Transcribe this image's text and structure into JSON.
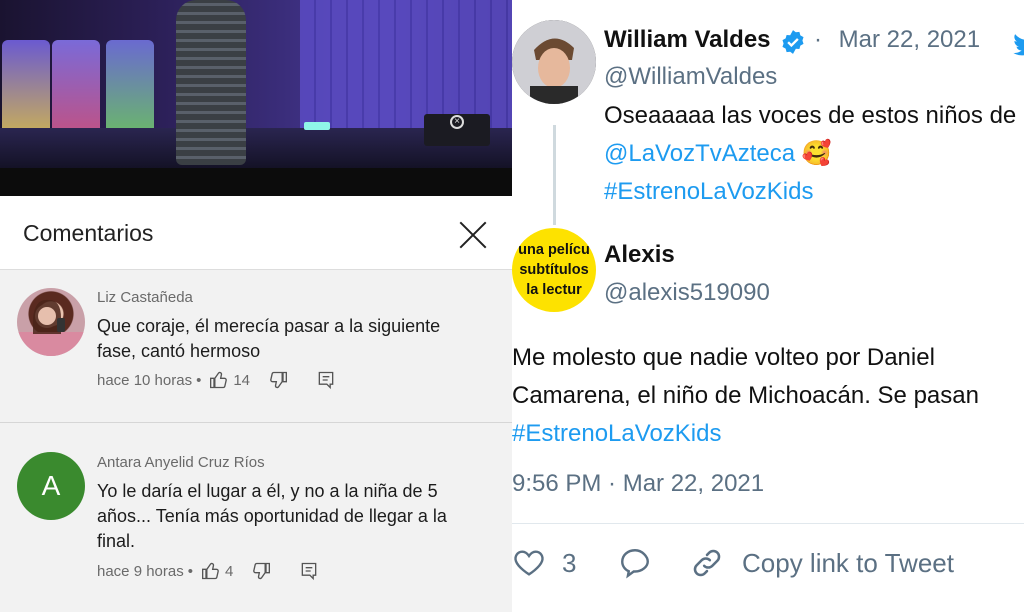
{
  "comments_panel": {
    "title": "Comentarios",
    "comments": [
      {
        "author": "Liz Castañeda",
        "text_line1": "Que coraje, él merecía pasar a la siguiente",
        "text_line2": "fase, cantó hermoso",
        "time": "hace 10 horas",
        "likes": "14"
      },
      {
        "author": "Antara Anyelid Cruz Ríos",
        "avatar_letter": "A",
        "text_line1": "Yo le daría el lugar a él, y no a la niña de 5",
        "text_line2": "años... Tenía más oportunidad de llegar a la",
        "text_line3": "final.",
        "time": "hace 9 horas",
        "likes": "4"
      }
    ],
    "colors": {
      "avatar_green": "#3a8a2e"
    }
  },
  "tweet_original": {
    "name": "William Valdes",
    "handle": "@WilliamValdes",
    "date": "Mar 22, 2021",
    "separator": "·",
    "text_line1": "Oseaaaaa las voces de estos niños de",
    "mention": "@LaVozTvAzteca",
    "emoji": "🥰",
    "hashtag": "#EstrenoLaVozKids",
    "verified": true
  },
  "tweet_reply": {
    "name": "Alexis",
    "handle": "@alexis519090",
    "avatar_text": [
      "una pelícu",
      "subtítulos",
      "la lectur"
    ],
    "text_line1": "Me molesto que nadie volteo por Daniel",
    "text_line2": "Camarena, el niño de Michoacán. Se pasan",
    "hashtag": "#EstrenoLaVozKids",
    "timestamp": "9:56 PM · Mar 22, 2021",
    "likes": "3",
    "copy_link": "Copy link to Tweet"
  },
  "colors": {
    "twitter_blue": "#1d9bf0",
    "muted": "#5b7083"
  }
}
